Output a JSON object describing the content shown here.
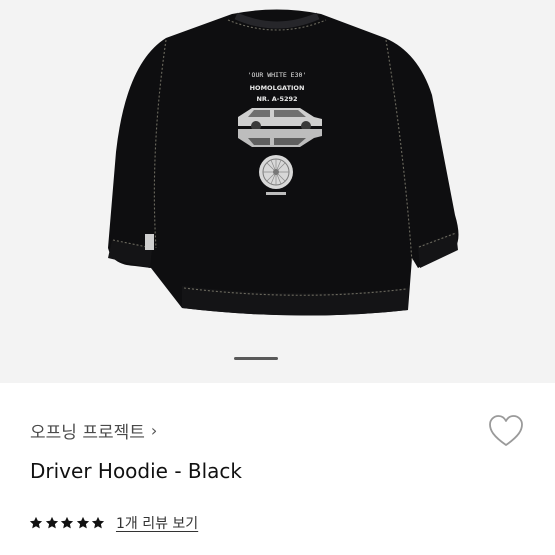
{
  "product": {
    "print_lines": [
      "'OUR WHITE E30'",
      "HOMOLGATION",
      "NR. A-5292"
    ],
    "brand": "오프닝 프로젝트",
    "brand_chevron": "›",
    "title": "Driver Hoodie - Black",
    "rating": 5,
    "rating_max": 5,
    "reviews_link": "1개 리뷰 보기"
  },
  "icons": {
    "brand_chevron": "chevron-right-icon",
    "wishlist": "heart-outline-icon",
    "star": "star-filled-icon"
  },
  "colors": {
    "gallery_bg": "#f3f3f3",
    "garment": "#0e0e10",
    "stitching": "#6c6a5f",
    "pager_active": "#595959",
    "star": "#111111",
    "heart_stroke": "#9a9a9a"
  },
  "gallery": {
    "current": 1
  }
}
